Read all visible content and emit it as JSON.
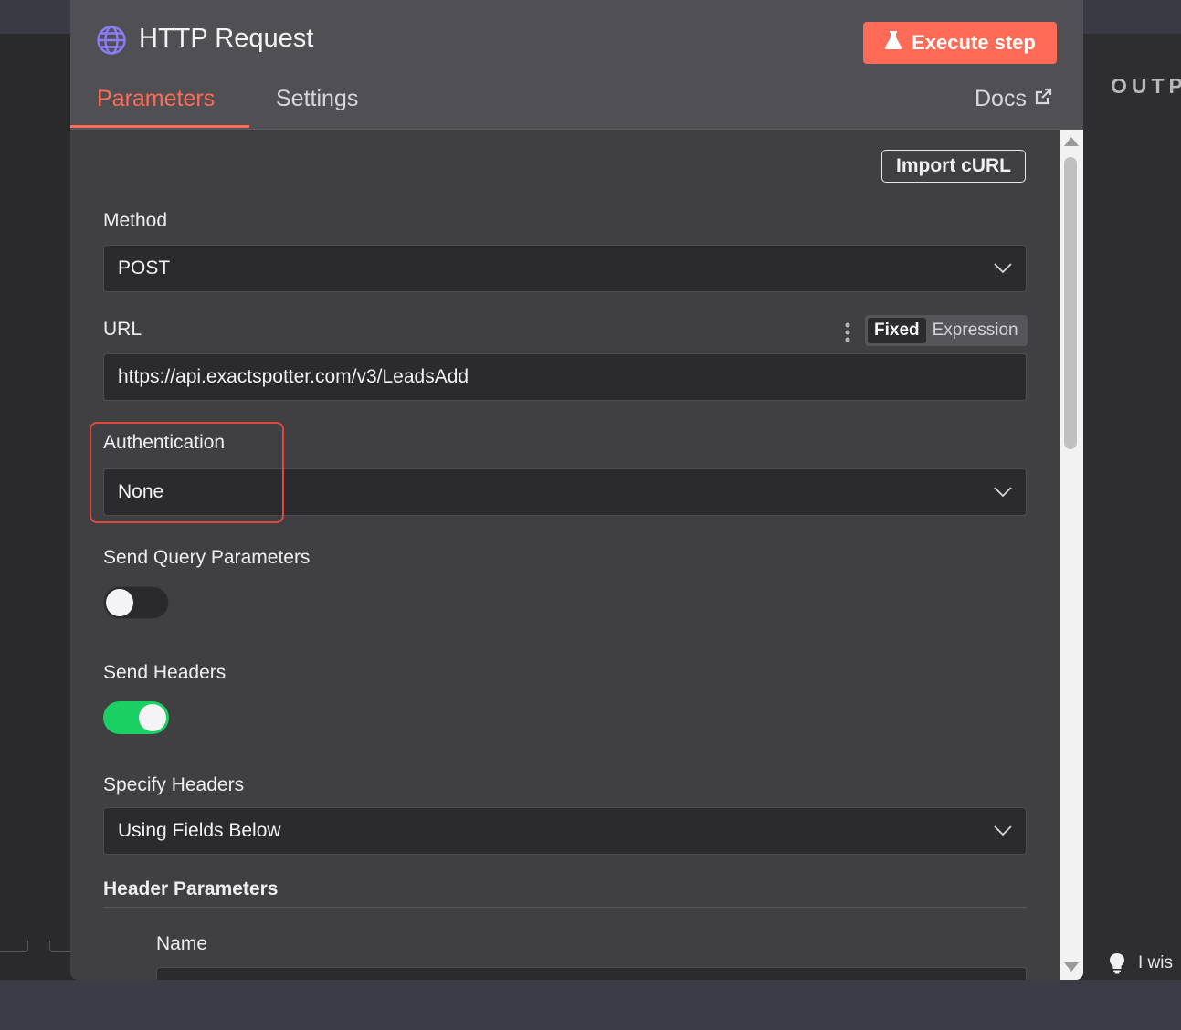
{
  "dialog": {
    "title": "HTTP Request",
    "title_icon": "globe-icon",
    "execute_button": "Execute step",
    "execute_icon": "flask-icon",
    "tabs": [
      {
        "label": "Parameters",
        "active": true
      },
      {
        "label": "Settings",
        "active": false
      }
    ],
    "docs_label": "Docs",
    "docs_icon": "external-link-icon"
  },
  "parameters": {
    "import_curl_label": "Import cURL",
    "method": {
      "label": "Method",
      "value": "POST"
    },
    "url": {
      "label": "URL",
      "value": "https://api.exactspotter.com/v3/LeadsAdd",
      "mode_fixed": "Fixed",
      "mode_expression": "Expression",
      "active_mode": "Fixed"
    },
    "authentication": {
      "label": "Authentication",
      "value": "None"
    },
    "send_query_parameters": {
      "label": "Send Query Parameters",
      "enabled": false
    },
    "send_headers": {
      "label": "Send Headers",
      "enabled": true
    },
    "specify_headers": {
      "label": "Specify Headers",
      "value": "Using Fields Below"
    },
    "header_parameters": {
      "label": "Header Parameters",
      "name_label": "Name"
    }
  },
  "output_panel": {
    "title": "OUTP"
  },
  "tip": {
    "text": "I wis",
    "icon": "lightbulb-icon"
  },
  "colors": {
    "accent": "#ff6b57",
    "toggle_on": "#1ad063",
    "highlight": "#e0473d",
    "dialog_bg": "#404043",
    "input_bg": "#2b2b2d"
  }
}
